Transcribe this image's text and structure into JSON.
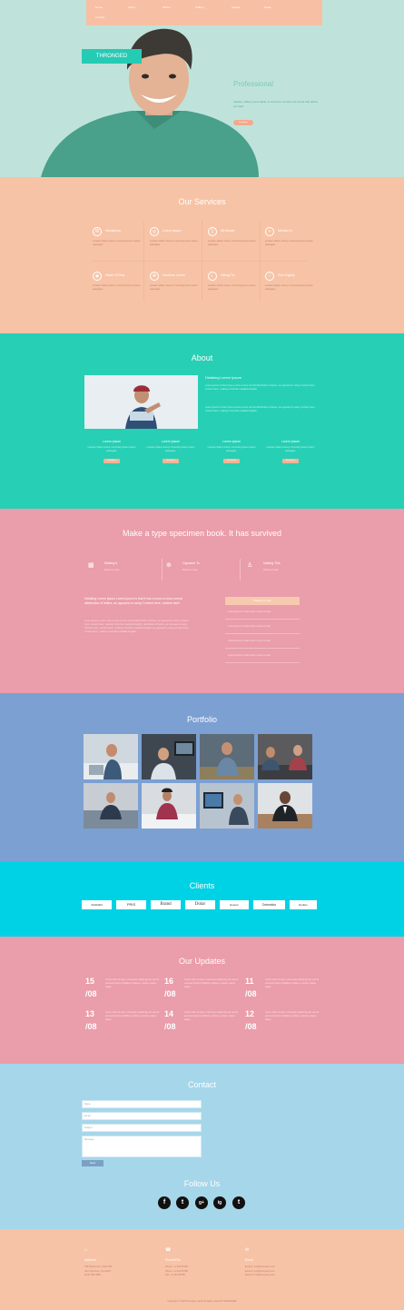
{
  "nav": {
    "items": [
      "Home",
      "About",
      "Works",
      "Gallery",
      "Clients",
      "News",
      "Contact"
    ]
  },
  "hero": {
    "brand": "THRONGED",
    "heading": "Professional",
    "text": "reliable, skilled, personable, & consumer service are words that define our staff.",
    "button": "Read More"
  },
  "services": {
    "title": "Our Services",
    "items": [
      {
        "title": "Wordpress",
        "icon": "wordpress-icon",
        "desc": "Lorisam dolem ciueny xmnorcing lorem ipsum passages."
      },
      {
        "title": "Lorem Ipsum",
        "icon": "compass-icon",
        "desc": "Lorisam dolem ciueny xmnorcing lorem ipsum passages."
      },
      {
        "title": "All Mouse",
        "icon": "mouse-icon",
        "desc": "Lorisam dolem ciueny xmnorcing lorem ipsum passages."
      },
      {
        "title": "Mention In",
        "icon": "plus-icon",
        "desc": "Lorisam dolem ciueny xmnorcing lorem ipsum passages."
      },
      {
        "title": "Hitate Of Sea",
        "icon": "target-icon",
        "desc": "Lorisam dolem ciueny xmnorcing lorem ipsum passages."
      },
      {
        "title": "Dominac Lorem",
        "icon": "gear-icon",
        "desc": "Lorisam dolem ciueny xmnorcing lorem ipsum passages."
      },
      {
        "title": "Hiding Tiu",
        "icon": "eye-icon",
        "desc": "Lorisam dolem ciueny xmnorcing lorem ipsum passages."
      },
      {
        "title": "Exer Dignity",
        "icon": "star-icon",
        "desc": "Lorisam dolem ciueny xmnorcing lorem ipsum passages."
      }
    ]
  },
  "about": {
    "title": "About",
    "heading": "Delaking Lorem Ipsum",
    "p1": "Lorem ipsum is that it has a more-or-less normal distribution of letters, as opposed to using 'Content here, content here', making it look like readable English.",
    "p2": "Lorem ipsum is that it has a more-or-less normal distribution of letters, as opposed to using 'Content here, content here', making it look like readable English.",
    "cols": [
      {
        "title": "Lorem Ipsum",
        "desc": "Lorisam dolem ciueny xmnorcing lorem ipsum passages.",
        "button": "Read More"
      },
      {
        "title": "Lorem Ipsum",
        "desc": "Lorisam dolem ciueny xmnorcing lorem ipsum passages.",
        "button": "Read More"
      },
      {
        "title": "Lorem Ipsum",
        "desc": "Lorisam dolem ciueny xmnorcing lorem ipsum passages.",
        "button": "Read More"
      },
      {
        "title": "Lorem Ipsum",
        "desc": "Lorisam dolem ciueny xmnorcing lorem ipsum passages.",
        "button": "Read More"
      }
    ]
  },
  "type": {
    "title": "Make a type specimen book. It has survived",
    "features": [
      {
        "title": "Making It",
        "desc": "Market at date",
        "icon": "calendar-icon"
      },
      {
        "title": "Opposed To",
        "desc": "Market at date",
        "icon": "globe-icon"
      },
      {
        "title": "Making This",
        "desc": "Market at date",
        "icon": "user-icon"
      }
    ],
    "lead": "Delaking Lorem Ipsum Lorem Ipsum is that it has a more-or-less normal distribution of letters, as opposed to using 'Content here, content here'.",
    "body": "Lorem ipsum is that it has a more-or-less normal distribution of letters, as opposed to using 'Content here, content here', making it look like readable English. distribution of letters, as opposed to using 'Content here, content here', making it look like readable English, as opposed to using 'Content here, content here', making it look like readable English.",
    "list_title": "Making It cook",
    "list": [
      "Lorem ipsum is that it has a more-or-less",
      "Lorem ipsum is that it has a more-or-less",
      "Lorem ipsum is that it has a more-or-less",
      "Lorem ipsum is that it has a more-or-less"
    ]
  },
  "portfolio": {
    "title": "Portfolio"
  },
  "clients": {
    "title": "Clients",
    "logos": [
      "ANADEN",
      "PRIS",
      "Brand",
      "Dolar",
      "Everes",
      "Dotmatics",
      "Emitter"
    ]
  },
  "updates": {
    "title": "Our Updates",
    "items": [
      {
        "day": "15",
        "month": "/08",
        "desc": "Aorum dolor sit amet, consectetur adipiscing elit, sed do eiusmod tempor incididunt ut labore et dolore magna aliqua."
      },
      {
        "day": "16",
        "month": "/08",
        "desc": "Aorum dolor sit amet, consectetur adipiscing elit, sed do eiusmod tempor incididunt ut labore et dolore magna aliqua."
      },
      {
        "day": "11",
        "month": "/08",
        "desc": "Aorum dolor sit amet, consectetur adipiscing elit, sed do eiusmod tempor incididunt ut labore et dolore magna aliqua."
      },
      {
        "day": "13",
        "month": "/08",
        "desc": "Aorum dolor sit amet, consectetur adipiscing elit, sed do eiusmod tempor incididunt ut labore et dolore magna aliqua."
      },
      {
        "day": "14",
        "month": "/08",
        "desc": "Aorum dolor sit amet, consectetur adipiscing elit, sed do eiusmod tempor incididunt ut labore et dolore magna aliqua."
      },
      {
        "day": "12",
        "month": "/08",
        "desc": "Aorum dolor sit amet, consectetur adipiscing elit, sed do eiusmod tempor incididunt ut labore et dolore magna aliqua."
      }
    ]
  },
  "contact": {
    "title": "Contact",
    "name_ph": "Name",
    "email_ph": "Email",
    "subject_ph": "Subject",
    "message_ph": "Message",
    "send": "Send",
    "follow": "Follow Us",
    "social": [
      "f",
      "t",
      "g+",
      "ig",
      "t"
    ]
  },
  "footer": {
    "cols": [
      {
        "icon": "home-icon",
        "title": "Address",
        "lines": [
          "756 Wilson Ave, Suite 600",
          "San Francisco, CA 94107",
          "(123) 456-7890"
        ]
      },
      {
        "icon": "phone-icon",
        "title": "Phone/Fax",
        "lines": [
          "Phone: +1 234 56789",
          "Phone: +1 234 56789",
          "Fax: +1 234 56789"
        ]
      },
      {
        "icon": "mail-icon",
        "title": "Email",
        "lines": [
          "Email 1: info@company.com",
          "Email 2: info@company.com",
          "Email 3: info@company.com"
        ]
      }
    ],
    "copyright": "Copyright © 2015 Company name All rights reserved THRONGED"
  }
}
